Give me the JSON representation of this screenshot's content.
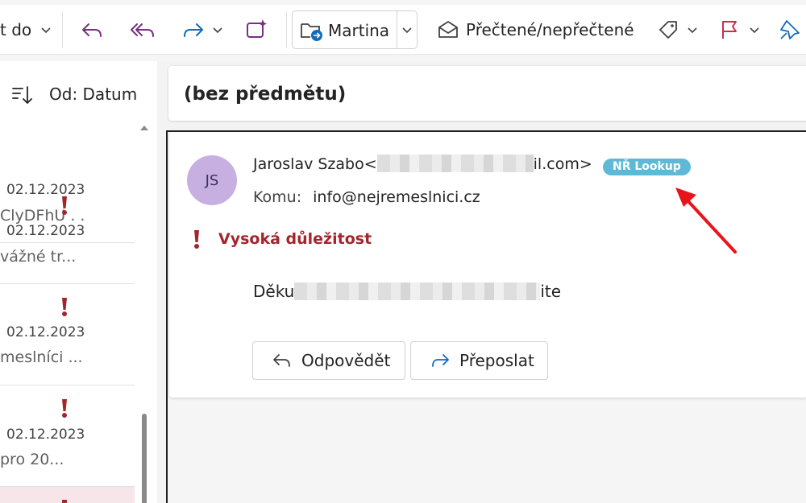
{
  "toolbar": {
    "move_to_label": "t do",
    "category_button_label": "Martina",
    "read_unread_label": "Přečtené/nepřečtené"
  },
  "list": {
    "sort_label": "Od: Datum",
    "items": [
      {
        "date": "02.12.2023",
        "snippet": "ClyDFhU . .",
        "important": false
      },
      {
        "date": "02.12.2023",
        "snippet": "vážné tr...",
        "important": true
      },
      {
        "date": "02.12.2023",
        "snippet": "meslníci ...",
        "important": true
      },
      {
        "date": "02.12.2023",
        "snippet": "pro 20...",
        "important": true
      }
    ]
  },
  "message": {
    "subject": "(bez předmětu)",
    "avatar_initials": "JS",
    "sender_name": "Jaroslav Szabo<",
    "sender_email_tail": "il.com>",
    "badge": "NŘ Lookup",
    "to_label": "Komu:",
    "to_address": "info@nejremeslnici.cz",
    "importance": "Vysoká důležitost",
    "body_start": "Děku",
    "body_end": "ite",
    "reply_label": "Odpovědět",
    "forward_label": "Přeposlat"
  },
  "colors": {
    "accent": "#0f6cbd",
    "importance": "#a4262c",
    "badge": "#5fb9d6",
    "avatar": "#c7b0e1",
    "annotation_arrow": "#e8141c",
    "icon_purple": "#7a2d84"
  }
}
